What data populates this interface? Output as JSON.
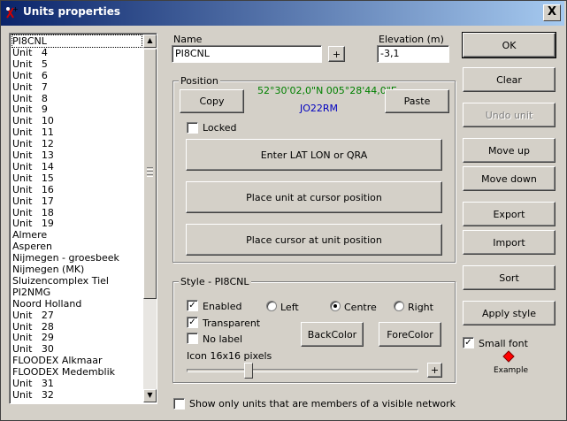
{
  "window": {
    "title": "Units properties",
    "close_label": "X"
  },
  "unit_list": {
    "items": [
      "PI8CNL",
      "Unit   4",
      "Unit   5",
      "Unit   6",
      "Unit   7",
      "Unit   8",
      "Unit   9",
      "Unit   10",
      "Unit   11",
      "Unit   12",
      "Unit   13",
      "Unit   14",
      "Unit   15",
      "Unit   16",
      "Unit   17",
      "Unit   18",
      "Unit   19",
      "Almere",
      "Asperen",
      "Nijmegen - groesbeek",
      "Nijmegen (MK)",
      "Sluizencomplex Tiel",
      "PI2NMG",
      "Noord Holland",
      "Unit   27",
      "Unit   28",
      "Unit   29",
      "Unit   30",
      "FLOODEX Alkmaar",
      "FLOODEX Medemblik",
      "Unit   31",
      "Unit   32"
    ],
    "selected_index": 0
  },
  "name_field": {
    "label": "Name",
    "value": "PI8CNL",
    "plus_label": "+"
  },
  "elevation_field": {
    "label": "Elevation (m)",
    "value": "-3,1"
  },
  "position": {
    "title": "Position",
    "copy_label": "Copy",
    "paste_label": "Paste",
    "coords": "52°30'02,0\"N 005°28'44,0\"E",
    "qra": "JO22RM",
    "coords_color": "#008000",
    "qra_color": "#0000c0",
    "locked_label": "Locked",
    "locked_checked": false,
    "enter_latlon_label": "Enter LAT LON or QRA",
    "place_unit_label": "Place unit at cursor position",
    "place_cursor_label": "Place cursor at unit position"
  },
  "style": {
    "title": "Style - PI8CNL",
    "enabled_label": "Enabled",
    "enabled_checked": true,
    "transparent_label": "Transparent",
    "transparent_checked": true,
    "nolabel_label": "No label",
    "nolabel_checked": false,
    "left_label": "Left",
    "centre_label": "Centre",
    "right_label": "Right",
    "align_selected": "centre",
    "backcolor_label": "BackColor",
    "forecolor_label": "ForeColor",
    "icon_label": "Icon 16x16 pixels",
    "plus_label": "+"
  },
  "show_only_label": "Show only units that are members of a visible network",
  "show_only_checked": false,
  "buttons": {
    "ok": "OK",
    "clear": "Clear",
    "undo_unit": "Undo unit",
    "move_up": "Move up",
    "move_down": "Move down",
    "export": "Export",
    "import": "Import",
    "sort": "Sort",
    "apply_style": "Apply style"
  },
  "small_font_label": "Small font",
  "small_font_checked": true,
  "example_label": "Example",
  "example_color": "#ff0000"
}
